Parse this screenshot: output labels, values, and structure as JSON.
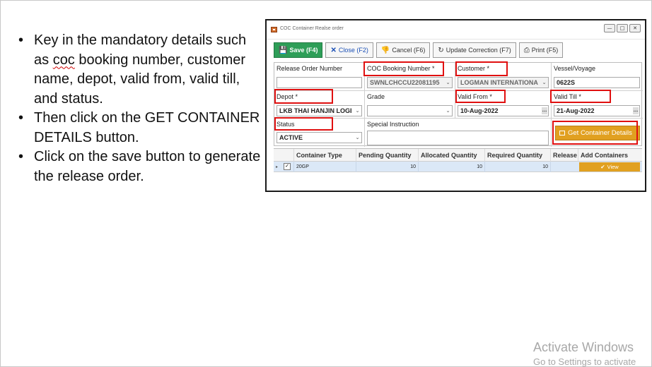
{
  "bullets": {
    "b1_pre": "Key in the mandatory details such as ",
    "b1_coc": "coc",
    "b1_post": " booking number, customer name, depot, valid from, valid till, and status.",
    "b2": "Then click on the GET CONTAINER DETAILS button.",
    "b3": "Click on the save button to generate the release order."
  },
  "window": {
    "title": "COC Container Realse order",
    "btn_min": "—",
    "btn_max": "□",
    "btn_close": "✕"
  },
  "toolbar": {
    "save_label": "Save (F4)",
    "save_icon": "💾",
    "close_label": "Close (F2)",
    "close_icon": "✕",
    "cancel_label": "Cancel (F6)",
    "cancel_icon": "👎",
    "update_label": "Update Correction (F7)",
    "update_icon": "↻",
    "print_label": "Print (F5)",
    "print_icon": "⎙"
  },
  "form": {
    "release_order_number": {
      "label": "Release Order Number",
      "value": ""
    },
    "coc_booking_number": {
      "label": "COC Booking Number *",
      "value": "SWNLCHCCU22081195"
    },
    "customer": {
      "label": "Customer *",
      "value": "LOGMAN INTERNATIONA"
    },
    "vessel_voyage": {
      "label": "Vessel/Voyage",
      "value": "0622S"
    },
    "depot": {
      "label": "Depot *",
      "value": "LKB THAI HANJIN LOGI"
    },
    "grade": {
      "label": "Grade",
      "value": ""
    },
    "valid_from": {
      "label": "Valid From *",
      "value": "10-Aug-2022"
    },
    "valid_till": {
      "label": "Valid Till *",
      "value": "21-Aug-2022"
    },
    "status": {
      "label": "Status",
      "value": "ACTIVE"
    },
    "special_instruction": {
      "label": "Special Instruction",
      "value": ""
    },
    "get_container_details": "Get Container Details"
  },
  "grid": {
    "headers": [
      "Container Type",
      "Pending Quantity",
      "Allocated Quantity",
      "Required Quantity",
      "Release",
      "Add Containers"
    ],
    "row": {
      "container_type": "20GP",
      "pending": "10",
      "allocated": "10",
      "required": "10",
      "release": "",
      "view_label": "View",
      "view_icon": "✔",
      "checked": "✓"
    }
  },
  "watermark": {
    "line1": "Activate Windows",
    "line2": "Go to Settings to activate"
  }
}
